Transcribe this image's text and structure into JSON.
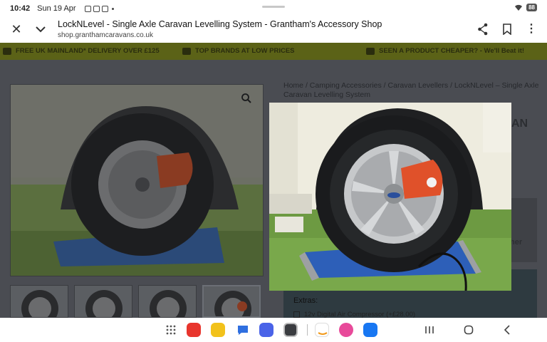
{
  "status": {
    "time": "10:42",
    "date": "Sun 19 Apr",
    "battery": "88"
  },
  "browser": {
    "title": "LockNLevel - Single Axle Caravan Levelling System - Grantham's Accessory Shop",
    "url": "shop.granthamcaravans.co.uk",
    "icons": [
      "close-icon",
      "chevron-down-icon",
      "share-icon",
      "bookmark-icon",
      "more-vertical-icon"
    ]
  },
  "promo": {
    "item1": "FREE UK MAINLAND* DELIVERY OVER £125",
    "item2": "TOP BRANDS AT LOW PRICES",
    "item3": "SEEN A PRODUCT CHEAPER? - We'll Beat it!"
  },
  "product": {
    "breadcrumb": {
      "home": "Home",
      "cat1": "Camping Accessories",
      "cat2": "Caravan Levellers",
      "current": "LockNLevel – Single Axle Caravan Levelling System",
      "separator": "/"
    },
    "partial_title": "AN",
    "partial_button": "her",
    "extras_label": "Extras:",
    "extras_option": "12v Digital Air Compressor (+£28.00)"
  },
  "dock": {
    "apps": [
      "app-grid-icon",
      "notes-app-icon",
      "files-app-icon",
      "messages-app-icon",
      "browser-app-icon",
      "camera-app-icon",
      "amazon-app-icon",
      "gallery-app-icon",
      "facebook-app-icon"
    ],
    "nav": [
      "recents-icon",
      "home-icon",
      "back-icon"
    ]
  },
  "colors": {
    "promo_bg": "#5b6217",
    "overlay_bg": "#4b4d52",
    "tarp_blue": "#2d5fb8",
    "leveller_orange": "#e0512a"
  }
}
